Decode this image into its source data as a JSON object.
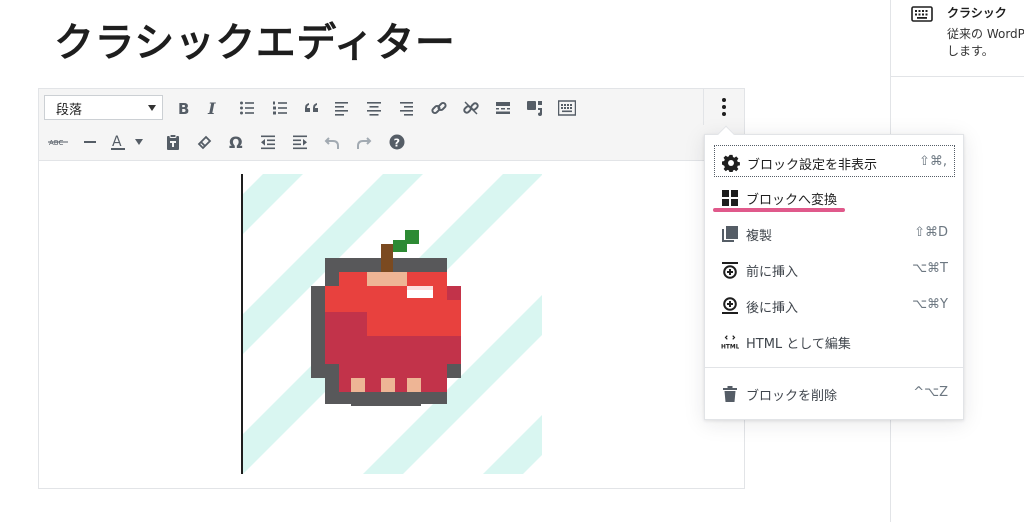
{
  "post": {
    "title": "クラシックエディター"
  },
  "sidebar": {
    "block_title": "クラシック",
    "block_desc_line1": "従来の WordP",
    "block_desc_line2": "します。",
    "icon": "keyboard-icon"
  },
  "toolbar": {
    "format_select": "段落",
    "row1": [
      "bold-icon",
      "italic-icon",
      "bulleted-list-icon",
      "numbered-list-icon",
      "blockquote-icon",
      "align-left-icon",
      "align-center-icon",
      "align-right-icon",
      "link-icon",
      "unlink-icon",
      "read-more-icon",
      "media-icon",
      "toolbar-toggle-icon"
    ],
    "row2": [
      "strikethrough-icon",
      "horizontal-rule-icon",
      "text-color-icon",
      "paste-as-text-icon",
      "clear-formatting-icon",
      "special-character-icon",
      "outdent-icon",
      "indent-icon",
      "undo-icon",
      "redo-icon",
      "help-icon"
    ],
    "more_icon": "more-options-icon"
  },
  "menu": {
    "items": [
      {
        "label": "ブロック設定を非表示",
        "shortcut": "⇧⌘,",
        "icon": "gear-icon"
      },
      {
        "label": "ブロックへ変換",
        "shortcut": "",
        "icon": "blocks-icon"
      },
      {
        "label": "複製",
        "shortcut": "⇧⌘D",
        "icon": "duplicate-icon"
      },
      {
        "label": "前に挿入",
        "shortcut": "⌥⌘T",
        "icon": "insert-before-icon"
      },
      {
        "label": "後に挿入",
        "shortcut": "⌥⌘Y",
        "icon": "insert-after-icon"
      },
      {
        "label": "HTML として編集",
        "shortcut": "",
        "icon": "html-icon"
      },
      {
        "label": "ブロックを削除",
        "shortcut": "^⌥Z",
        "icon": "trash-icon"
      }
    ],
    "highlight_color": "#e0598b"
  },
  "colors": {
    "stripe": "#d9f6f1",
    "apple_red": "#e8413e",
    "apple_dark": "#c2334a",
    "outline": "#58585a"
  }
}
